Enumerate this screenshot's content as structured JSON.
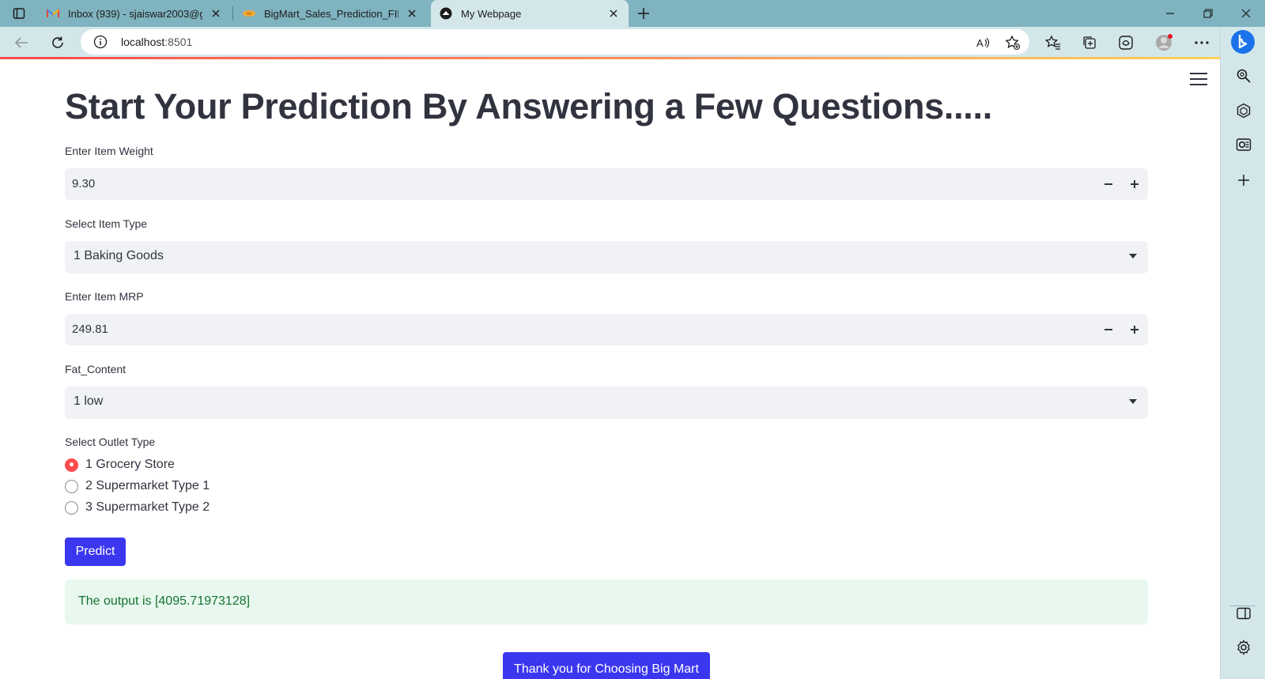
{
  "browser": {
    "tabs": [
      {
        "title": "Inbox (939) - sjaiswar2003@gma",
        "favicon": "gmail-icon"
      },
      {
        "title": "BigMart_Sales_Prediction_FINAL_",
        "favicon": "jupyter-icon"
      },
      {
        "title": "My Webpage",
        "favicon": "streamlit-icon",
        "active": true
      }
    ],
    "url_host": "localhost",
    "url_port": ":8501",
    "accent_colors": {
      "frame": "#7fb3bf",
      "toolbar": "#d3e7eb"
    }
  },
  "app": {
    "title": "Start Your Prediction By Answering a Few Questions.....",
    "weight": {
      "label": "Enter Item Weight",
      "value": "9.30"
    },
    "item_type": {
      "label": "Select Item Type",
      "value": "1 Baking Goods"
    },
    "mrp": {
      "label": "Enter Item MRP",
      "value": "249.81"
    },
    "fat": {
      "label": "Fat_Content",
      "value": "1 low"
    },
    "outlet": {
      "label": "Select Outlet Type",
      "options": [
        "1 Grocery Store",
        "2 Supermarket Type 1",
        "3 Supermarket Type 2"
      ],
      "selected": "1 Grocery Store"
    },
    "predict_label": "Predict",
    "output_text": "The output is [4095.71973128]",
    "thanks_label": "Thank you for Choosing Big Mart",
    "colors": {
      "primary": "#3b37f0",
      "radio_selected": "#ff4b4b",
      "success_bg": "#e8f8ee",
      "success_text": "#177233",
      "input_bg": "#f0f2f6"
    }
  }
}
